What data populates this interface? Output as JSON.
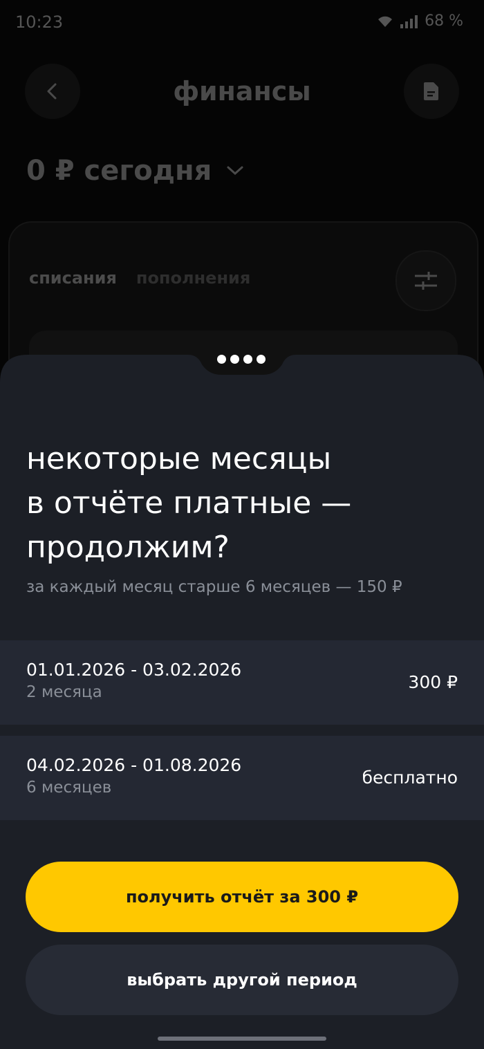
{
  "status_bar": {
    "time": "10:23",
    "battery": "68 %"
  },
  "header": {
    "title": "финансы",
    "back_icon": "chevron-left-icon",
    "doc_icon": "document-icon"
  },
  "balance": {
    "label": "0 ₽ сегодня",
    "dropdown_icon": "chevron-down-icon"
  },
  "tabs": [
    {
      "label": "списания",
      "active": true
    },
    {
      "label": "пополнения",
      "active": false
    }
  ],
  "filter_icon": "sliders-icon",
  "sheet": {
    "title_lines": [
      "некоторые месяцы",
      "в отчёте платные —",
      "продолжим?"
    ],
    "subtitle": "за каждый месяц старше 6 месяцев — 150 ₽",
    "periods": [
      {
        "range": "01.01.2026 - 03.02.2026",
        "months": "2 месяца",
        "price": "300 ₽"
      },
      {
        "range": "04.02.2026 - 01.08.2026",
        "months": "6 месяцев",
        "price": "бесплатно"
      }
    ],
    "primary_button": "получить отчёт за 300 ₽",
    "secondary_button": "выбрать другой период"
  },
  "colors": {
    "accent": "#ffc800",
    "sheet_bg": "#1c1f26",
    "row_bg": "#242833",
    "secondary_text": "#8a8f98"
  }
}
